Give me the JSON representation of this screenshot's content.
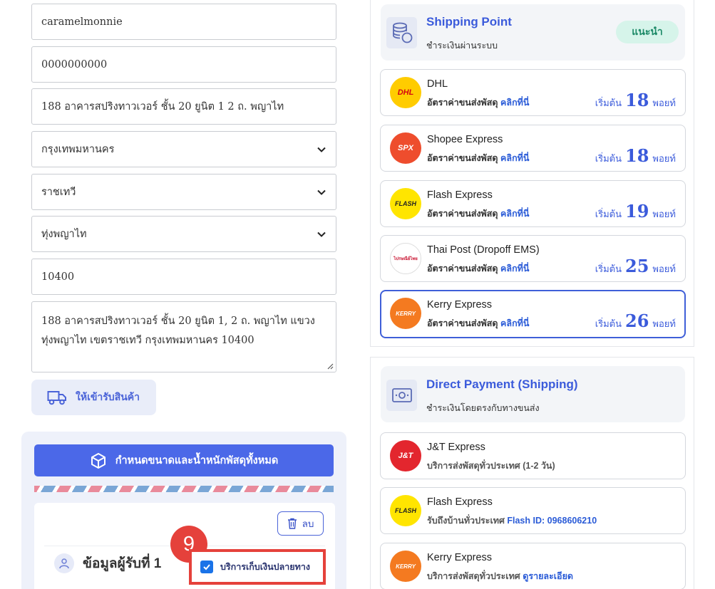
{
  "form": {
    "username": "caramelmonnie",
    "phone": "0000000000",
    "address_line": "188 อาคารสปริงทาวเวอร์ ชั้น 20 ยูนิต 1 2 ถ. พญาไท",
    "province": "กรุงเทพมหานคร",
    "district": "ราชเทวี",
    "subdistrict": "ทุ่งพญาไท",
    "postcode": "10400",
    "full_address": "188 อาคารสปริงทาวเวอร์ ชั้น 20 ยูนิต 1, 2 ถ. พญาไท แขวงทุ่งพญาไท เขตราชเทวี กรุงเทพมหานคร 10400",
    "pickup_button": "ให้เข้ารับสินค้า"
  },
  "parcel": {
    "size_button": "กำหนดขนาดและน้ำหนักพัสดุทั้งหมด",
    "delete_button": "ลบ",
    "receiver_title": "ข้อมูลผู้รับที่ 1",
    "step_badge": "9",
    "cod_label": "บริการเก็บเงินปลายทาง",
    "cod_checked": true
  },
  "shipping_point": {
    "title": "Shipping Point",
    "subtitle": "ชำระเงินผ่านระบบ",
    "recommend": "แนะนำ",
    "carriers": [
      {
        "name": "DHL",
        "rate_text": "อัตราค่าขนส่งพัสดุ",
        "link": "คลิกที่นี่",
        "price_prefix": "เริ่มต้น",
        "price": "18",
        "unit": "พอยท์",
        "logo_text": "DHL",
        "logo_bg": "#ffcc00",
        "logo_fg": "#d40511"
      },
      {
        "name": "Shopee Express",
        "rate_text": "อัตราค่าขนส่งพัสดุ",
        "link": "คลิกที่นี่",
        "price_prefix": "เริ่มต้น",
        "price": "18",
        "unit": "พอยท์",
        "logo_text": "SPX",
        "logo_bg": "#ee4d2d",
        "logo_fg": "#ffffff"
      },
      {
        "name": "Flash Express",
        "rate_text": "อัตราค่าขนส่งพัสดุ",
        "link": "คลิกที่นี่",
        "price_prefix": "เริ่มต้น",
        "price": "19",
        "unit": "พอยท์",
        "logo_text": "FLASH",
        "logo_bg": "#ffe500",
        "logo_fg": "#222222"
      },
      {
        "name": "Thai Post (Dropoff EMS)",
        "rate_text": "อัตราค่าขนส่งพัสดุ",
        "link": "คลิกที่นี่",
        "price_prefix": "เริ่มต้น",
        "price": "25",
        "unit": "พอยท์",
        "logo_text": "ไปรษณีย์ไทย",
        "logo_bg": "#ffffff",
        "logo_fg": "#c8102e"
      },
      {
        "name": "Kerry Express",
        "rate_text": "อัตราค่าขนส่งพัสดุ",
        "link": "คลิกที่นี่",
        "price_prefix": "เริ่มต้น",
        "price": "26",
        "unit": "พอยท์",
        "logo_text": "KERRY",
        "logo_bg": "#f47a20",
        "logo_fg": "#ffffff"
      }
    ]
  },
  "direct_payment": {
    "title": "Direct Payment (Shipping)",
    "subtitle": "ชำระเงินโดยตรงกับทางขนส่ง",
    "carriers": [
      {
        "name": "J&T Express",
        "desc": "บริการส่งพัสดุทั่วประเทศ (1-2 วัน)",
        "link": "",
        "logo_text": "J&T",
        "logo_bg": "#e3262e",
        "logo_fg": "#ffffff"
      },
      {
        "name": "Flash Express",
        "desc": "รับถึงบ้านทั่วประเทศ",
        "link": "Flash ID: 0968606210",
        "logo_text": "FLASH",
        "logo_bg": "#ffe500",
        "logo_fg": "#222222"
      },
      {
        "name": "Kerry Express",
        "desc": "บริการส่งพัสดุทั่วประเทศ",
        "link": "ดูรายละเอียด",
        "logo_text": "KERRY",
        "logo_bg": "#f47a20",
        "logo_fg": "#ffffff"
      }
    ]
  },
  "colors": {
    "accent": "#3b5bdb",
    "highlight": "#e5413b",
    "recommend_bg": "#d6f4ea"
  },
  "selected_carrier": "Kerry Express"
}
